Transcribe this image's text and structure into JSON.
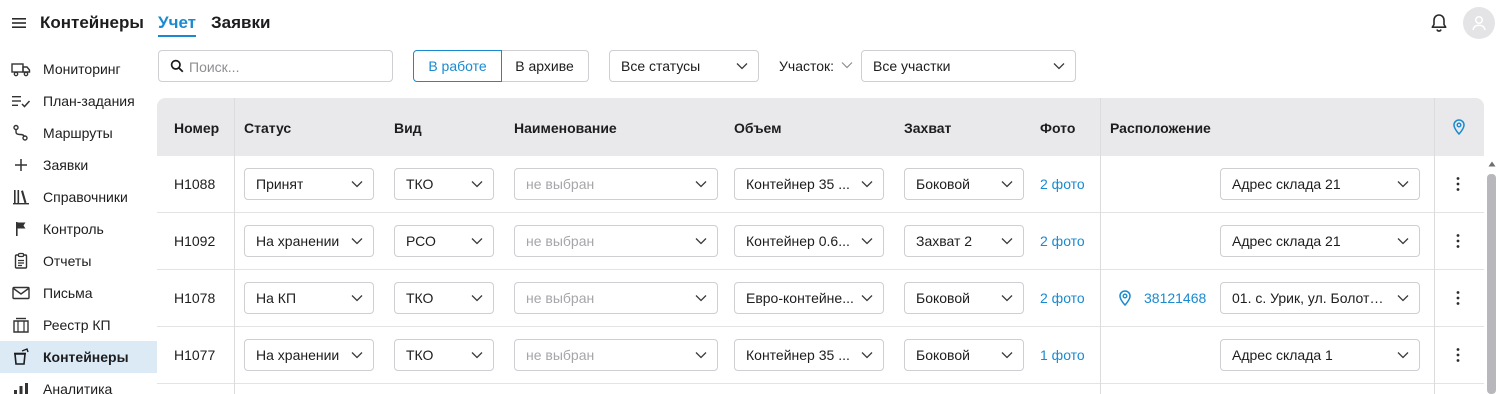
{
  "header": {
    "app_title": "Контейнеры",
    "tabs": [
      {
        "label": "Учет",
        "active": true
      },
      {
        "label": "Заявки",
        "active": false
      }
    ],
    "accent_color": "#1a8ad0"
  },
  "sidebar": {
    "items": [
      {
        "label": "Мониторинг",
        "icon": "truck-icon"
      },
      {
        "label": "План-задания",
        "icon": "checklist-icon"
      },
      {
        "label": "Маршруты",
        "icon": "route-icon"
      },
      {
        "label": "Заявки",
        "icon": "plus-icon"
      },
      {
        "label": "Справочники",
        "icon": "library-icon"
      },
      {
        "label": "Контроль",
        "icon": "flag-icon"
      },
      {
        "label": "Отчеты",
        "icon": "report-icon"
      },
      {
        "label": "Письма",
        "icon": "mail-icon"
      },
      {
        "label": "Реестр КП",
        "icon": "registry-icon"
      },
      {
        "label": "Контейнеры",
        "icon": "container-icon",
        "active": true
      },
      {
        "label": "Аналитика",
        "icon": "analytics-icon"
      }
    ]
  },
  "filters": {
    "search_placeholder": "Поиск...",
    "segment_active": "В работе",
    "segment_inactive": "В архиве",
    "status_select": "Все статусы",
    "site_label": "Участок:",
    "site_select": "Все участки"
  },
  "table": {
    "columns": {
      "number": "Номер",
      "status": "Статус",
      "kind": "Вид",
      "name": "Наименование",
      "volume": "Объем",
      "grip": "Захват",
      "photo": "Фото",
      "location": "Расположение"
    },
    "rows": [
      {
        "number": "Н1088",
        "status": "Принят",
        "kind": "ТКО",
        "name": "не выбран",
        "volume": "Контейнер 35 ...",
        "grip": "Боковой",
        "photo": "2 фото",
        "location_id": "",
        "location": "Адрес склада 21"
      },
      {
        "number": "Н1092",
        "status": "На хранении",
        "kind": "РСО",
        "name": "не выбран",
        "volume": "Контейнер 0.6...",
        "grip": "Захват 2",
        "photo": "2 фото",
        "location_id": "",
        "location": "Адрес склада 21"
      },
      {
        "number": "Н1078",
        "status": "На КП",
        "kind": "ТКО",
        "name": "не выбран",
        "volume": "Евро-контейне...",
        "grip": "Боковой",
        "photo": "2 фото",
        "location_id": "38121468",
        "location": "01. с. Урик, ул. Болотна..."
      },
      {
        "number": "Н1077",
        "status": "На хранении",
        "kind": "ТКО",
        "name": "не выбран",
        "volume": "Контейнер 35 ...",
        "grip": "Боковой",
        "photo": "1 фото",
        "location_id": "",
        "location": "Адрес склада 1"
      }
    ]
  }
}
